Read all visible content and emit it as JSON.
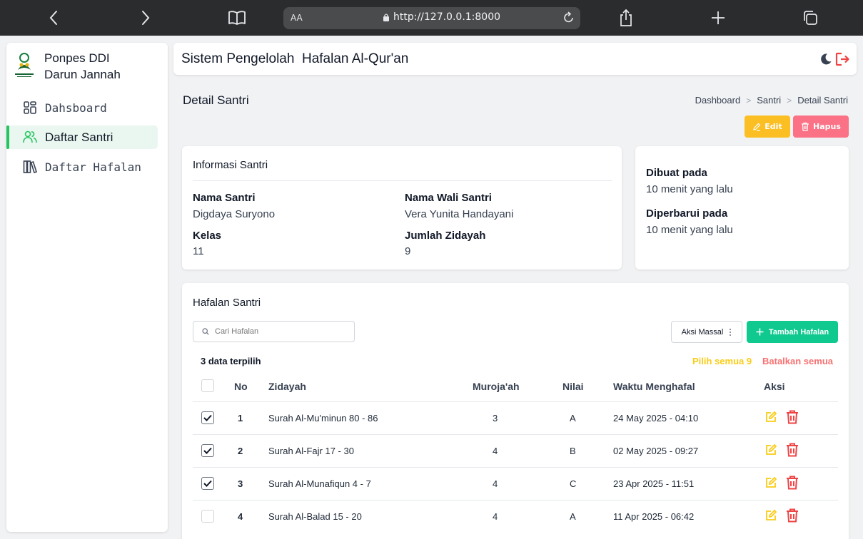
{
  "browser": {
    "text_size_label": "AA",
    "url": "http://127.0.0.1:8000"
  },
  "sidebar": {
    "brand_line1": "Ponpes DDI",
    "brand_line2": "Darun Jannah",
    "items": [
      {
        "label": "Dahsboard",
        "icon": "dashboard-icon"
      },
      {
        "label": "Daftar Santri",
        "icon": "users-icon",
        "active": true
      },
      {
        "label": "Daftar Hafalan",
        "icon": "books-icon"
      }
    ]
  },
  "header": {
    "title": "Sistem Pengelolah  Hafalan Al-Qur'an"
  },
  "page": {
    "title": "Detail Santri",
    "breadcrumb": [
      "Dashboard",
      "Santri",
      "Detail Santri"
    ],
    "edit_label": "Edit",
    "delete_label": "Hapus"
  },
  "info": {
    "title": "Informasi Santri",
    "nama_label": "Nama Santri",
    "nama_value": "Digdaya Suryono",
    "wali_label": "Nama Wali Santri",
    "wali_value": "Vera Yunita Handayani",
    "kelas_label": "Kelas",
    "kelas_value": "11",
    "zidayah_label": "Jumlah Zidayah",
    "zidayah_value": "9"
  },
  "meta": {
    "created_label": "Dibuat pada",
    "created_value": "10 menit yang lalu",
    "updated_label": "Diperbarui pada",
    "updated_value": "10 menit yang lalu"
  },
  "hafalan": {
    "title": "Hafalan Santri",
    "search_placeholder": "Cari Hafalan",
    "bulk_label": "Aksi Massal",
    "add_label": "Tambah Hafalan",
    "selected_text": "3 data terpilih",
    "select_all_label": "Pilih semua 9",
    "cancel_all_label": "Batalkan semua",
    "columns": [
      "No",
      "Zidayah",
      "Muroja'ah",
      "Nilai",
      "Waktu Menghafal",
      "Aksi"
    ],
    "rows": [
      {
        "no": "1",
        "zidayah": "Surah Al-Mu'minun 80 - 86",
        "murojaah": "3",
        "nilai": "A",
        "waktu": "24 May 2025 - 04:10",
        "checked": true
      },
      {
        "no": "2",
        "zidayah": "Surah Al-Fajr 17 - 30",
        "murojaah": "4",
        "nilai": "B",
        "waktu": "02 May 2025 - 09:27",
        "checked": true
      },
      {
        "no": "3",
        "zidayah": "Surah Al-Munafiqun 4 - 7",
        "murojaah": "4",
        "nilai": "C",
        "waktu": "23 Apr 2025 - 11:51",
        "checked": true
      },
      {
        "no": "4",
        "zidayah": "Surah Al-Balad 15 - 20",
        "murojaah": "4",
        "nilai": "A",
        "waktu": "11 Apr 2025 - 06:42",
        "checked": false
      }
    ]
  },
  "colors": {
    "accent_green": "#10c98f",
    "edit_yellow": "#fbbf24",
    "delete_red": "#fb7185"
  }
}
